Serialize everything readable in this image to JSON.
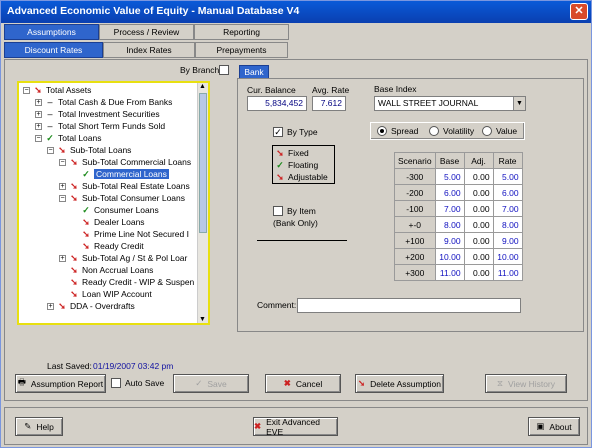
{
  "window": {
    "title": "Advanced Economic Value of Equity - Manual Database V4"
  },
  "tabs_top": [
    {
      "label": "Assumptions"
    },
    {
      "label": "Process / Review"
    },
    {
      "label": "Reporting"
    }
  ],
  "tabs_second": [
    {
      "label": "Discount Rates"
    },
    {
      "label": "Index Rates"
    },
    {
      "label": "Prepayments"
    }
  ],
  "by_branch": {
    "label": "By Branch"
  },
  "bank_tab": {
    "label": "Bank"
  },
  "tree": {
    "items": [
      {
        "label": "Total Assets"
      },
      {
        "label": "Total Cash & Due From Banks"
      },
      {
        "label": "Total Investment Securities"
      },
      {
        "label": "Total Short Term Funds Sold"
      },
      {
        "label": "Total Loans"
      },
      {
        "label": "Sub-Total Loans"
      },
      {
        "label": "Sub-Total Commercial Loans"
      },
      {
        "label": "Commercial Loans"
      },
      {
        "label": "Sub-Total Real Estate Loans"
      },
      {
        "label": "Sub-Total Consumer Loans"
      },
      {
        "label": "Consumer Loans"
      },
      {
        "label": "Dealer Loans"
      },
      {
        "label": "Prime Line Not Secured I"
      },
      {
        "label": "Ready Credit"
      },
      {
        "label": "Sub-Total Ag / St & Pol Loar"
      },
      {
        "label": "Non Accrual Loans"
      },
      {
        "label": "Ready Credit - WIP & Suspen"
      },
      {
        "label": "Loan WIP Account"
      },
      {
        "label": "DDA - Overdrafts"
      }
    ]
  },
  "fields": {
    "cur_balance_label": "Cur. Balance",
    "cur_balance": "5,834,452",
    "avg_rate_label": "Avg. Rate",
    "avg_rate": "7.612",
    "base_index_label": "Base Index",
    "base_index": "WALL STREET JOURNAL"
  },
  "by_type": {
    "label": "By Type",
    "options": [
      {
        "label": "Fixed"
      },
      {
        "label": "Floating"
      },
      {
        "label": "Adjustable"
      }
    ]
  },
  "by_item": {
    "label": "By Item",
    "sub": "(Bank Only)"
  },
  "radios": [
    {
      "label": "Spread"
    },
    {
      "label": "Volatility"
    },
    {
      "label": "Value"
    }
  ],
  "scenario_table": {
    "headers": [
      "Scenario",
      "Base",
      "Adj.",
      "Rate"
    ],
    "rows": [
      [
        "-300",
        "5.00",
        "0.00",
        "5.00"
      ],
      [
        "-200",
        "6.00",
        "0.00",
        "6.00"
      ],
      [
        "-100",
        "7.00",
        "0.00",
        "7.00"
      ],
      [
        "+-0",
        "8.00",
        "0.00",
        "8.00"
      ],
      [
        "+100",
        "9.00",
        "0.00",
        "9.00"
      ],
      [
        "+200",
        "10.00",
        "0.00",
        "10.00"
      ],
      [
        "+300",
        "11.00",
        "0.00",
        "11.00"
      ]
    ]
  },
  "comment": {
    "label": "Comment:",
    "value": ""
  },
  "status": {
    "last_saved_label": "Last Saved:",
    "last_saved": "01/19/2007 03:42 pm"
  },
  "buttons": {
    "assumption_report": "Assumption Report",
    "auto_save": "Auto Save",
    "save": "Save",
    "cancel": "Cancel",
    "delete_assumption": "Delete Assumption",
    "view_history": "View History",
    "help": "Help",
    "exit": "Exit Advanced EVE",
    "about": "About"
  }
}
